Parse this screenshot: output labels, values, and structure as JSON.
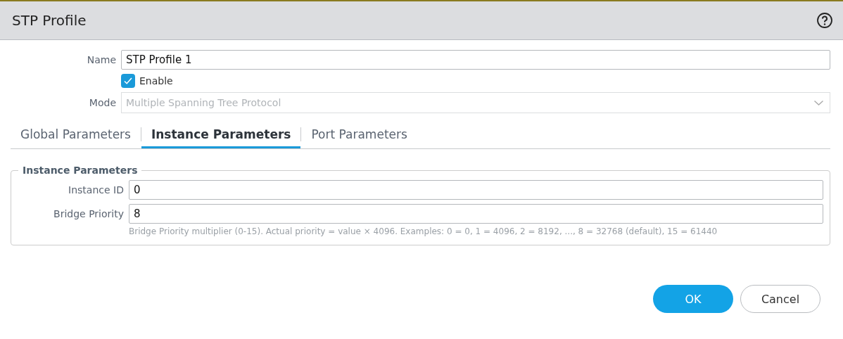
{
  "window": {
    "title": "STP Profile"
  },
  "name": {
    "label": "Name",
    "value": "STP Profile 1"
  },
  "enable": {
    "label": "Enable",
    "checked": true
  },
  "mode": {
    "label": "Mode",
    "value": "Multiple Spanning Tree Protocol",
    "disabled": true
  },
  "tabs": [
    {
      "label": "Global Parameters",
      "selected": false
    },
    {
      "label": "Instance Parameters",
      "selected": true
    },
    {
      "label": "Port Parameters",
      "selected": false
    }
  ],
  "group": {
    "title": "Instance Parameters",
    "fields": [
      {
        "label": "Instance ID",
        "value": "0"
      },
      {
        "label": "Bridge Priority",
        "value": "8"
      }
    ],
    "hint": "Bridge Priority multiplier (0-15). Actual priority = value × 4096. Examples: 0 = 0, 1 = 4096, 2 = 8192, ..., 8 = 32768 (default), 15 = 61440"
  },
  "buttons": [
    {
      "label": "OK",
      "kind": "primary"
    },
    {
      "label": "Cancel",
      "kind": "secondary"
    }
  ]
}
